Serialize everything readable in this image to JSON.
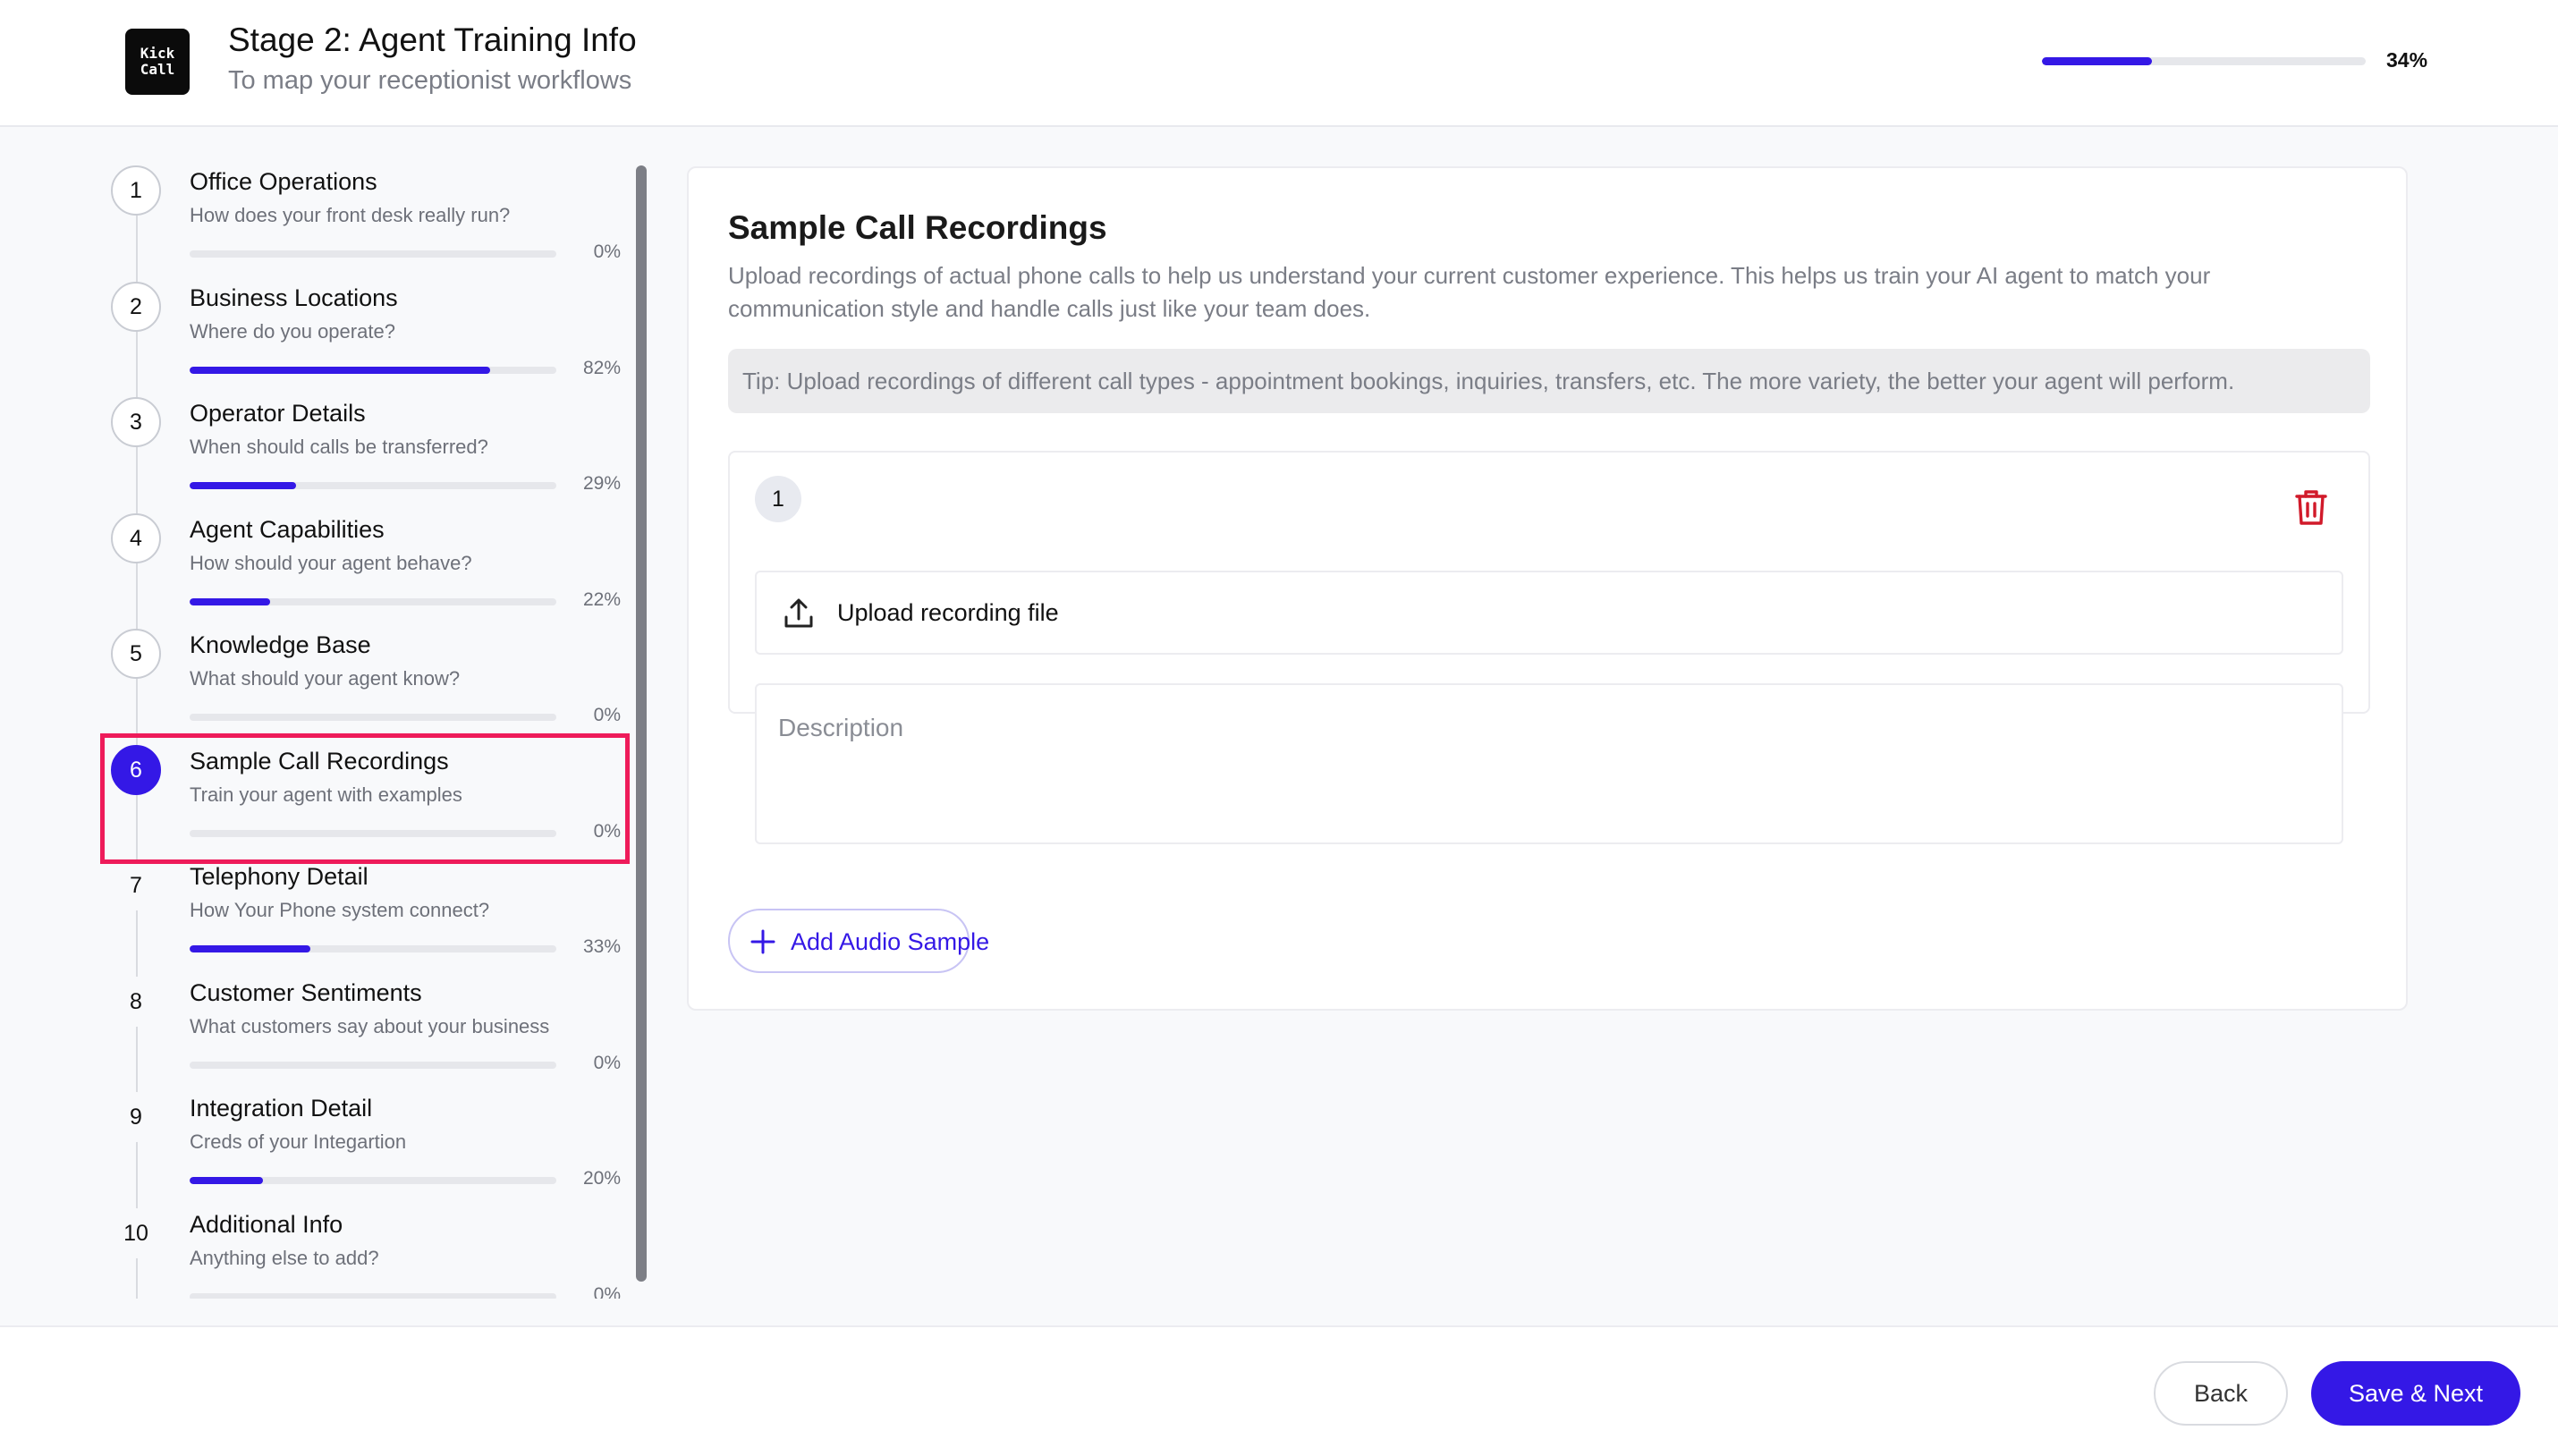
{
  "header": {
    "logo_line1": "Kick",
    "logo_line2": "Call",
    "title": "Stage 2: Agent Training Info",
    "subtitle": "To map your receptionist workflows",
    "progress_pct_label": "34%",
    "progress_value": 34
  },
  "sidebar": {
    "active_step": 6,
    "steps": [
      {
        "number": "1",
        "title": "Office Operations",
        "subtitle": "How does your front desk really run?",
        "pct_label": "0%",
        "progress": 0
      },
      {
        "number": "2",
        "title": "Business Locations",
        "subtitle": "Where do you operate?",
        "pct_label": "82%",
        "progress": 82
      },
      {
        "number": "3",
        "title": "Operator Details",
        "subtitle": "When should calls be transferred?",
        "pct_label": "29%",
        "progress": 29
      },
      {
        "number": "4",
        "title": "Agent Capabilities",
        "subtitle": "How should your agent behave?",
        "pct_label": "22%",
        "progress": 22
      },
      {
        "number": "5",
        "title": "Knowledge Base",
        "subtitle": "What should your agent know?",
        "pct_label": "0%",
        "progress": 0
      },
      {
        "number": "6",
        "title": "Sample Call Recordings",
        "subtitle": "Train your agent with examples",
        "pct_label": "0%",
        "progress": 0
      },
      {
        "number": "7",
        "title": "Telephony Detail",
        "subtitle": "How Your Phone system connect?",
        "pct_label": "33%",
        "progress": 33
      },
      {
        "number": "8",
        "title": "Customer Sentiments",
        "subtitle": "What customers say about your business",
        "pct_label": "0%",
        "progress": 0
      },
      {
        "number": "9",
        "title": "Integration Detail",
        "subtitle": "Creds of your Integartion",
        "pct_label": "20%",
        "progress": 20
      },
      {
        "number": "10",
        "title": "Additional Info",
        "subtitle": "Anything else to add?",
        "pct_label": "0%",
        "progress": 0
      }
    ]
  },
  "main": {
    "title": "Sample Call Recordings",
    "description": "Upload recordings of actual phone calls to help us understand your current customer experience. This helps us train your AI agent to match your communication style and handle calls just like your team does.",
    "tip": "Tip: Upload recordings of different call types - appointment bookings, inquiries, transfers, etc. The more variety, the better your agent will perform.",
    "sample": {
      "number": "1",
      "upload_label": "Upload recording file",
      "description_placeholder": "Description",
      "description_value": ""
    },
    "add_button_label": "Add Audio Sample"
  },
  "footer": {
    "back_label": "Back",
    "save_label": "Save & Next"
  },
  "colors": {
    "accent": "#3418e6",
    "highlight": "#ee1b5a",
    "danger": "#d11a2a",
    "muted_text": "#7a7d86"
  },
  "icons": {
    "upload": "upload-icon",
    "trash": "trash-icon",
    "plus": "plus-icon"
  }
}
